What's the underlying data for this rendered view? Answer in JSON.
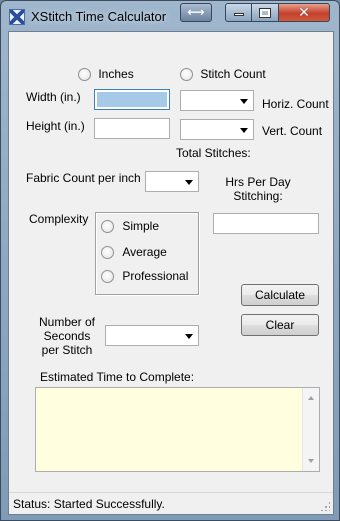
{
  "window": {
    "title": "XStitch Time Calculator",
    "swap_icon": "swap-arrows-icon",
    "minimize_icon": "minimize-icon",
    "maximize_icon": "maximize-icon",
    "close_icon": "close-icon"
  },
  "units": {
    "inches_label": "Inches",
    "stitch_count_label": "Stitch Count"
  },
  "dimensions": {
    "width_label": "Width (in.)",
    "height_label": "Height (in.)",
    "width_value": "",
    "height_value": "",
    "horiz_label": "Horiz. Count",
    "vert_label": "Vert. Count",
    "horiz_value": "",
    "vert_value": "",
    "total_stitches_label": "Total Stitches:"
  },
  "fabric": {
    "label": "Fabric Count per inch",
    "value": ""
  },
  "hours": {
    "label_line1": "Hrs Per Day",
    "label_line2": "Stitching:",
    "value": ""
  },
  "complexity": {
    "label": "Complexity",
    "options": [
      "Simple",
      "Average",
      "Professional"
    ]
  },
  "buttons": {
    "calculate": "Calculate",
    "clear": "Clear"
  },
  "seconds": {
    "line1": "Number of",
    "line2": "Seconds",
    "line3": "per Stitch",
    "value": ""
  },
  "estimate": {
    "label": "Estimated Time to Complete:",
    "value": ""
  },
  "status": {
    "text": "Status: Started Successfully."
  },
  "colors": {
    "result_background": "#ffffe0",
    "focus_selection": "#a6c9e8",
    "close_button": "#c4412c"
  }
}
